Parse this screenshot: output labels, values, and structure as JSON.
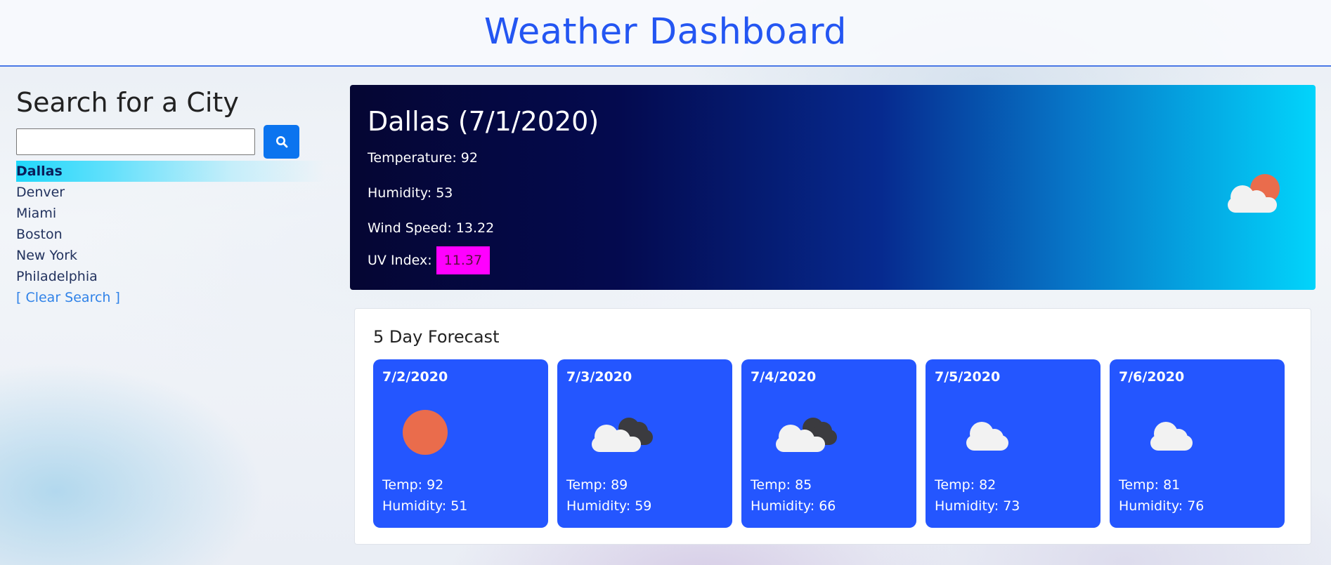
{
  "header": {
    "title": "Weather Dashboard"
  },
  "sidebar": {
    "heading": "Search for a City",
    "search": {
      "value": "",
      "placeholder": "",
      "button_icon": "search-icon"
    },
    "cities": [
      "Dallas",
      "Denver",
      "Miami",
      "Boston",
      "New York",
      "Philadelphia"
    ],
    "active_city": "Dallas",
    "clear_label": "[ Clear Search ]"
  },
  "current": {
    "title": "Dallas (7/1/2020)",
    "temperature": "Temperature: 92",
    "humidity": "Humidity: 53",
    "wind": "Wind Speed: 13.22",
    "uv_label": "UV Index:",
    "uv_value": "11.37",
    "uv_color": "#ff00ff",
    "icon": "partly-cloudy-day-icon"
  },
  "forecast": {
    "heading": "5 Day Forecast",
    "days": [
      {
        "date": "7/2/2020",
        "icon": "sun-icon",
        "temp": "Temp: 92",
        "humidity": "Humidity: 51"
      },
      {
        "date": "7/3/2020",
        "icon": "broken-clouds-icon",
        "temp": "Temp: 89",
        "humidity": "Humidity: 59"
      },
      {
        "date": "7/4/2020",
        "icon": "broken-clouds-icon",
        "temp": "Temp: 85",
        "humidity": "Humidity: 66"
      },
      {
        "date": "7/5/2020",
        "icon": "cloud-icon",
        "temp": "Temp: 82",
        "humidity": "Humidity: 73"
      },
      {
        "date": "7/6/2020",
        "icon": "cloud-icon",
        "temp": "Temp: 81",
        "humidity": "Humidity: 76"
      }
    ]
  },
  "colors": {
    "accent": "#2456f2",
    "card": "#2456ff",
    "search_button": "#0b74ef",
    "link": "#2f82e8"
  }
}
